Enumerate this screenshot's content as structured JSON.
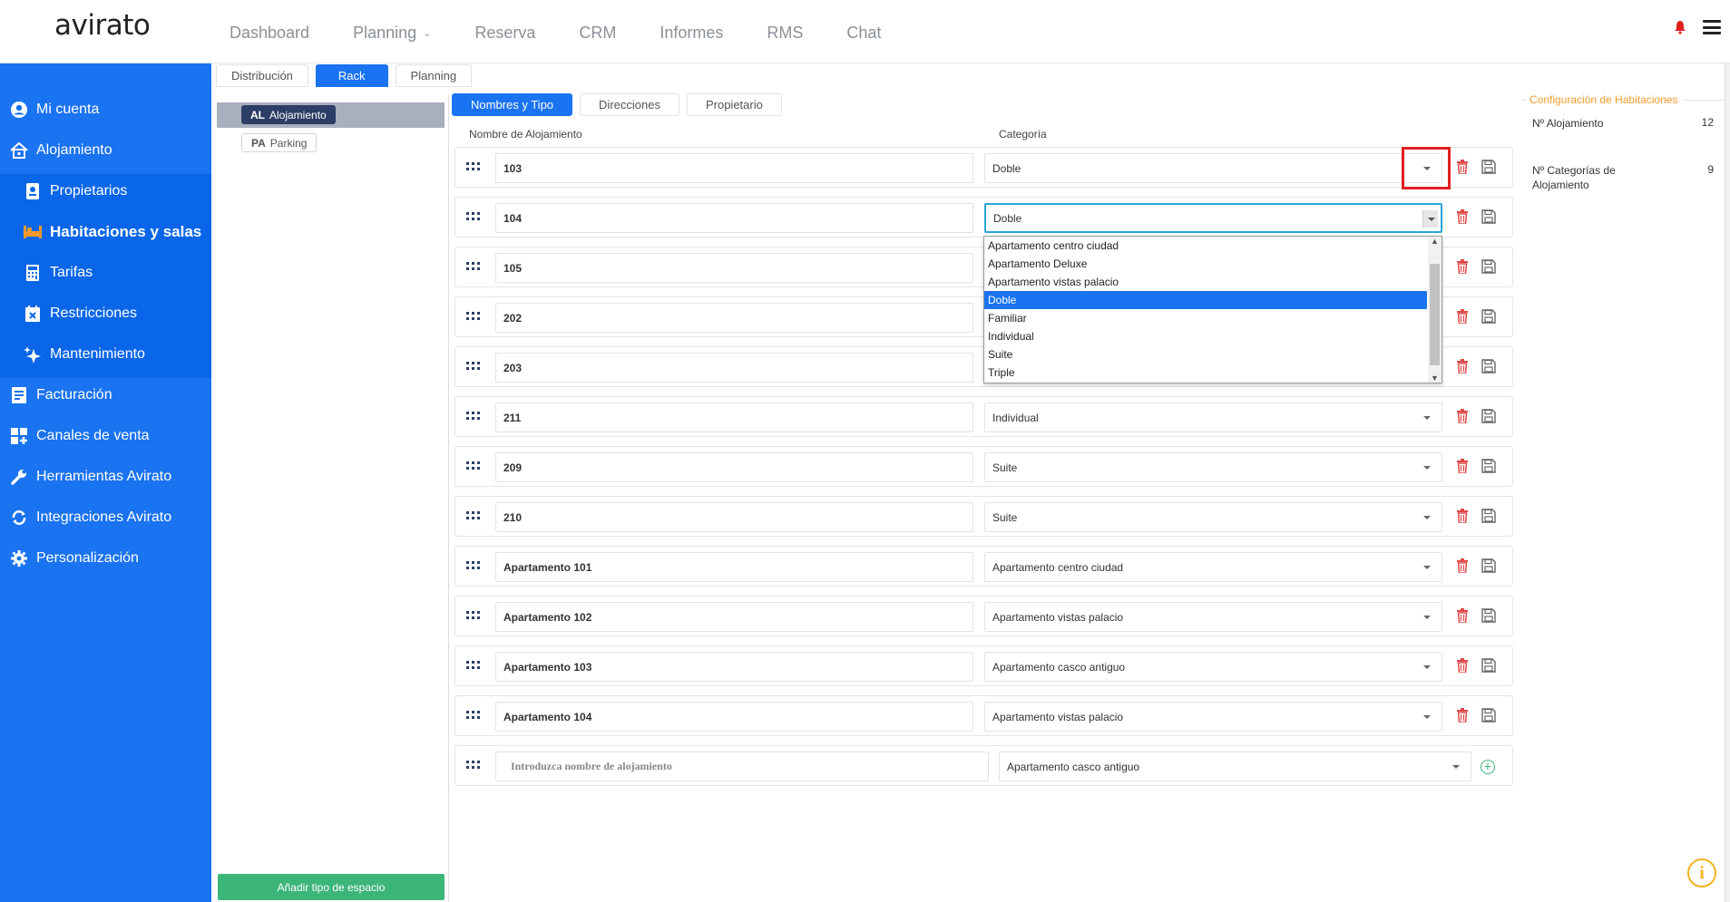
{
  "app": {
    "logo": "avirato"
  },
  "topnav": {
    "items": [
      {
        "label": "Dashboard"
      },
      {
        "label": "Planning",
        "has_dropdown": true
      },
      {
        "label": "Reserva"
      },
      {
        "label": "CRM"
      },
      {
        "label": "Informes"
      },
      {
        "label": "RMS"
      },
      {
        "label": "Chat"
      }
    ]
  },
  "sidebar": {
    "items": [
      {
        "label": "Mi cuenta",
        "icon": "user-circle-icon"
      },
      {
        "label": "Alojamiento",
        "icon": "house-icon"
      },
      {
        "label": "Propietarios",
        "icon": "id-card-icon"
      },
      {
        "label": "Habitaciones y salas",
        "icon": "bed-icon",
        "active": true
      },
      {
        "label": "Tarifas",
        "icon": "calculator-icon"
      },
      {
        "label": "Restricciones",
        "icon": "calendar-x-icon"
      },
      {
        "label": "Mantenimiento",
        "icon": "sparkle-icon"
      },
      {
        "label": "Facturación",
        "icon": "invoice-icon"
      },
      {
        "label": "Canales de venta",
        "icon": "grid-plus-icon"
      },
      {
        "label": "Herramientas Avirato",
        "icon": "wrench-icon"
      },
      {
        "label": "Integraciones Avirato",
        "icon": "sync-icon"
      },
      {
        "label": "Personalización",
        "icon": "gear-icon"
      }
    ]
  },
  "view_tabs": [
    {
      "label": "Distribución"
    },
    {
      "label": "Rack",
      "active": true
    },
    {
      "label": "Planning"
    }
  ],
  "space_types": [
    {
      "code": "AL",
      "label": "Alojamiento",
      "selected": true
    },
    {
      "code": "PA",
      "label": "Parking"
    }
  ],
  "add_space_type_button": "Añadir tipo de espacio",
  "subtabs": [
    {
      "label": "Nombres y Tipo",
      "active": true
    },
    {
      "label": "Direcciones"
    },
    {
      "label": "Propietario"
    }
  ],
  "columns": {
    "name": "Nombre de Alojamiento",
    "category": "Categoría"
  },
  "rooms": [
    {
      "name": "103",
      "category": "Doble"
    },
    {
      "name": "104",
      "category": "Doble",
      "open": true
    },
    {
      "name": "105",
      "category": ""
    },
    {
      "name": "202",
      "category": ""
    },
    {
      "name": "203",
      "category": ""
    },
    {
      "name": "211",
      "category": "Individual"
    },
    {
      "name": "209",
      "category": "Suite"
    },
    {
      "name": "210",
      "category": "Suite"
    },
    {
      "name": "Apartamento 101",
      "category": "Apartamento centro ciudad"
    },
    {
      "name": "Apartamento 102",
      "category": "Apartamento vistas palacio"
    },
    {
      "name": "Apartamento 103",
      "category": "Apartamento casco antiguo"
    },
    {
      "name": "Apartamento 104",
      "category": "Apartamento vistas palacio"
    }
  ],
  "category_options": [
    "Apartamento centro ciudad",
    "Apartamento Deluxe",
    "Apartamento vistas palacio",
    "Doble",
    "Familiar",
    "Individual",
    "Suite",
    "Triple"
  ],
  "selected_option": "Doble",
  "new_row": {
    "placeholder": "Introduzca nombre de  alojamiento",
    "category": "Apartamento casco antiguo"
  },
  "config_panel": {
    "title": "Configuración de Habitaciones",
    "stats": [
      {
        "label": "Nº Alojamiento",
        "value": "12"
      },
      {
        "label": "Nº Categorías de Alojamiento",
        "value": "9"
      }
    ]
  },
  "colors": {
    "primary": "#1a73f0",
    "sidebar_sub": "#0a66e8",
    "success": "#3cb579",
    "accent_orange": "#f39a2b",
    "danger": "#e02020"
  }
}
